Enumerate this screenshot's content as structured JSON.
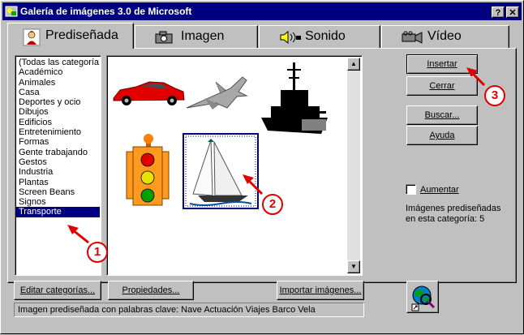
{
  "window": {
    "title": "Galería de imágenes 3.0 de Microsoft",
    "help_btn": "?",
    "close_btn": "✕"
  },
  "tabs": [
    {
      "label": "Prediseñada",
      "icon": "clipart-person-icon",
      "active": true
    },
    {
      "label": "Imagen",
      "icon": "camera-icon",
      "active": false
    },
    {
      "label": "Sonido",
      "icon": "speaker-icon",
      "active": false
    },
    {
      "label": "Vídeo",
      "icon": "video-camera-icon",
      "active": false
    }
  ],
  "categories": [
    "(Todas las categoría",
    "Académico",
    "Animales",
    "Casa",
    "Deportes y ocio",
    "Dibujos",
    "Edificios",
    "Entretenimiento",
    "Formas",
    "Gente trabajando",
    "Gestos",
    "Industria",
    "Plantas",
    "Screen Beans",
    "Signos",
    "Transporte"
  ],
  "selected_category": "Transporte",
  "gallery_items": [
    "red-sports-car",
    "fighter-jet",
    "battleship",
    "traffic-light",
    "sailboat"
  ],
  "selected_item": "sailboat",
  "buttons": {
    "insert": "Insertar",
    "close": "Cerrar",
    "search": "Buscar...",
    "help": "Ayuda",
    "edit_categories": "Editar categorías...",
    "properties": "Propiedades...",
    "import": "Importar imágenes..."
  },
  "enlarge_checkbox": {
    "label": "Aumentar",
    "checked": false
  },
  "category_info": "Imágenes prediseñadas en esta categoría: 5",
  "status_text": "Imagen prediseñada con palabras clave:  Nave Actuación Viajes Barco Vela",
  "callouts": [
    "1",
    "2",
    "3"
  ],
  "colors": {
    "title_bar": "#000080",
    "selection": "#000080",
    "callout": "#e00000",
    "face": "#c0c0c0"
  }
}
